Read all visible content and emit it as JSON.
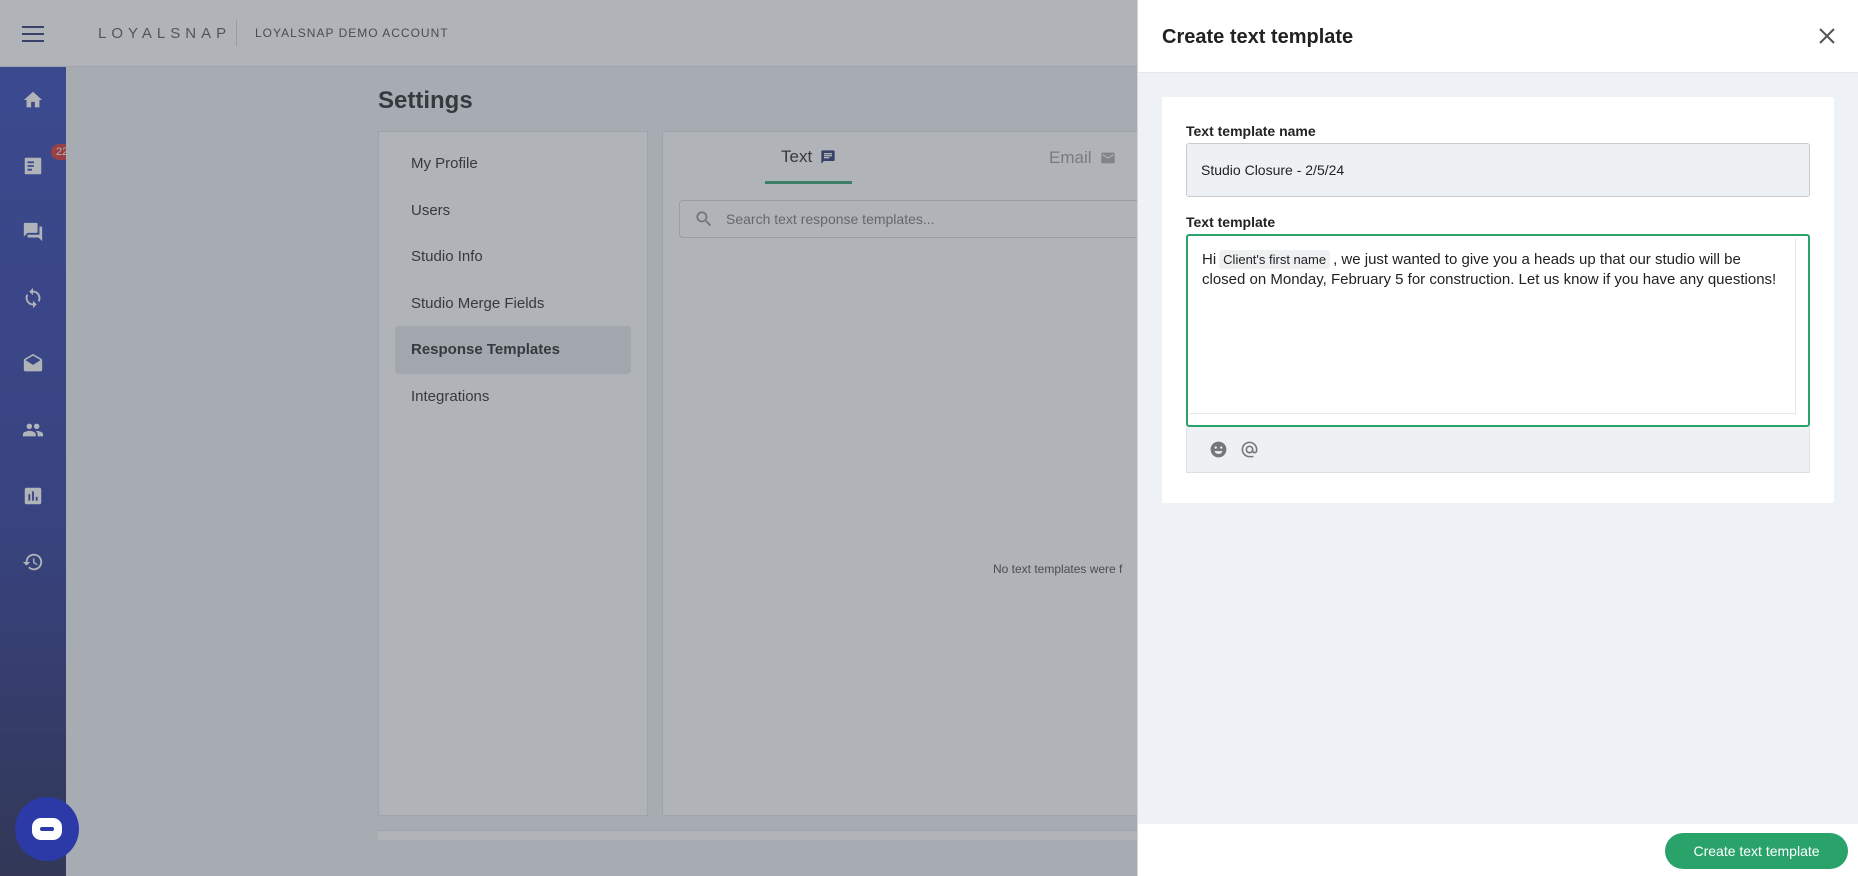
{
  "topbar": {
    "logo": "LOYALSNAP",
    "account_name": "LOYALSNAP DEMO ACCOUNT"
  },
  "sidebar": {
    "items": [
      {
        "name": "home-icon"
      },
      {
        "name": "tasks-icon",
        "badge": "22"
      },
      {
        "name": "chat-icon"
      },
      {
        "name": "sync-icon"
      },
      {
        "name": "mail-icon"
      },
      {
        "name": "people-icon"
      },
      {
        "name": "analytics-icon"
      },
      {
        "name": "history-icon"
      }
    ]
  },
  "settings": {
    "title": "Settings",
    "nav": [
      "My Profile",
      "Users",
      "Studio Info",
      "Studio Merge Fields",
      "Response Templates",
      "Integrations"
    ],
    "active_nav": "Response Templates"
  },
  "templates": {
    "tabs": [
      {
        "label": "Text",
        "active": true
      },
      {
        "label": "Email",
        "active": false
      }
    ],
    "search_placeholder": "Search text response templates...",
    "empty_message": "No text templates were f"
  },
  "drawer": {
    "title": "Create text template",
    "name_label": "Text template name",
    "name_value": "Studio Closure - 2/5/24",
    "template_label": "Text template",
    "template_prefix": "Hi",
    "merge_field": "Client's first name",
    "template_body": ", we just wanted to give you a heads up that our studio will be closed on Monday, February 5 for construction. Let us know if you have any questions!",
    "submit_label": "Create text template"
  },
  "colors": {
    "accent": "#2aa36b",
    "sidebar": "#2b3fb4",
    "badge": "#d32f2f"
  }
}
